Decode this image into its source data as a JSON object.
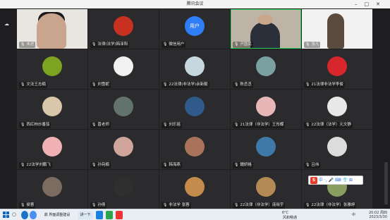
{
  "window": {
    "title": "腾讯会议",
    "controls": [
      "–",
      "□",
      "✕"
    ]
  },
  "sidebar": {
    "top_label": "张凡"
  },
  "participants": [
    {
      "name": "未进",
      "kind": "video"
    },
    {
      "name": "法律(法学)韩泽阳",
      "kind": "avatar",
      "color": "#c8301f"
    },
    {
      "name": "微信用户",
      "kind": "text",
      "label": "用户"
    },
    {
      "name": "开国民",
      "kind": "video2"
    },
    {
      "name": "张凡",
      "kind": "video3"
    },
    {
      "name": "文法王志楠",
      "kind": "avatar",
      "color": "#7da320"
    },
    {
      "name": "刘雪妮",
      "kind": "avatar",
      "color": "#f1f1f1"
    },
    {
      "name": "22法律(非法学)余新懿",
      "kind": "avatar",
      "color": "#c7d7e0"
    },
    {
      "name": "陈丞丞",
      "kind": "avatar",
      "color": "#7aa0a2"
    },
    {
      "name": "21法律非法学李俊",
      "kind": "avatar",
      "color": "#d8262d"
    },
    {
      "name": "西红柿炒番茄",
      "kind": "avatar",
      "color": "#d8c7a8"
    },
    {
      "name": "晋老师",
      "kind": "avatar",
      "color": "#61736a"
    },
    {
      "name": "刘乐瑶",
      "kind": "avatar",
      "color": "#305a8a"
    },
    {
      "name": "21法律（非法学）王彤蝶",
      "kind": "avatar",
      "color": "#e7b7b8"
    },
    {
      "name": "22法律（法学）元文静",
      "kind": "avatar",
      "color": "#e8e8e8"
    },
    {
      "name": "22法学刘鹏飞",
      "kind": "avatar",
      "color": "#f0b1b4"
    },
    {
      "name": "孙宛楠",
      "kind": "avatar",
      "color": "#cfa49c"
    },
    {
      "name": "韩海燕",
      "kind": "avatar",
      "color": "#a9735b"
    },
    {
      "name": "魏妍格",
      "kind": "avatar",
      "color": "#3e7aa8"
    },
    {
      "name": "吕伟",
      "kind": "avatar",
      "color": "#dcdcdc"
    },
    {
      "name": "侯蓉",
      "kind": "avatar",
      "color": "#7b6b60"
    },
    {
      "name": "孙倩",
      "kind": "avatar",
      "color": "#2f2f2f"
    },
    {
      "name": "非法学 张蓉",
      "kind": "avatar",
      "color": "#c58b4d"
    },
    {
      "name": "22法律（非法学）庞晓宇",
      "kind": "avatar",
      "color": "#b38a54"
    },
    {
      "name": "22法律（非法学）张雅婷",
      "kind": "avatar",
      "color": "#8a9e62"
    }
  ],
  "ime": {
    "logo": "S",
    "label": "中 ·, 🎤 ⌨ 👕 ⊞"
  },
  "taskbar": {
    "search": "○",
    "apps": [
      {
        "label": "鼎 界面调整建设",
        "color": "#dbe7f3"
      },
      {
        "label": "讲一下",
        "color": "#dbe7f3"
      }
    ],
    "weather": "6°C",
    "weather_desc": "风和畅通",
    "ime_lang": "中",
    "time": "20:02 周四",
    "date": "2023/3/30"
  }
}
